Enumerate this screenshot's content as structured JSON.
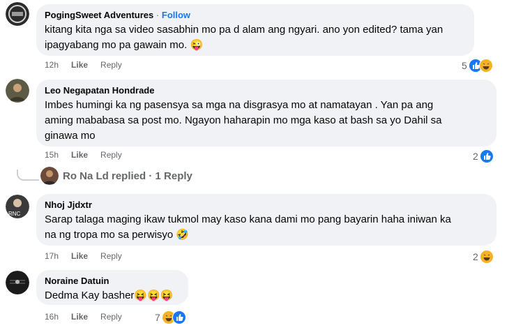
{
  "colors": {
    "bubble": "#f0f2f5",
    "like_blue": "#1877f2",
    "haha_yellow": "#f7b125",
    "secondary_text": "#65676b"
  },
  "comments": [
    {
      "author": "PogingSweet Adventures",
      "follow_sep": "·",
      "follow": "Follow",
      "lines": [
        "kitang kita nga sa video sasabhin mo pa d alam ang ngyari. ano yon edited? tama yan",
        "ipagyabang mo pa gawain mo. 😜"
      ],
      "time": "12h",
      "like": "Like",
      "reply": "Reply",
      "reaction_count": "5",
      "reactions": [
        "like-icon",
        "haha-icon"
      ]
    },
    {
      "author": "Leo Negapatan Hondrade",
      "lines": [
        "Imbes humingi ka ng pasensya sa mga na disgrasya mo at namatayan . Yan pa ang",
        "aming mababasa sa post mo. Ngayon haharapin mo mga kaso at bash sa yo Dahil sa",
        "ginawa mo"
      ],
      "time": "15h",
      "like": "Like",
      "reply": "Reply",
      "reaction_count": "2",
      "reactions": [
        "like-icon"
      ]
    },
    {
      "author": "Nhoj Jjdxtr",
      "lines": [
        "Sarap talaga maging ikaw tukmol may kaso kana dami mo pang bayarin haha iniwan ka",
        "na ng tropa mo sa perwisyo 🤣"
      ],
      "time": "17h",
      "like": "Like",
      "reply": "Reply",
      "reaction_count": "2",
      "reactions": [
        "haha-icon"
      ]
    },
    {
      "author": "Noraine Datuin",
      "lines": [
        "Dedma Kay basher😝😝😝"
      ],
      "time": "16h",
      "like": "Like",
      "reply": "Reply",
      "reaction_count": "7",
      "reactions": [
        "haha-icon",
        "like-icon"
      ]
    }
  ],
  "replies_link": {
    "text": "Ro Na Ld replied · 1 Reply"
  }
}
